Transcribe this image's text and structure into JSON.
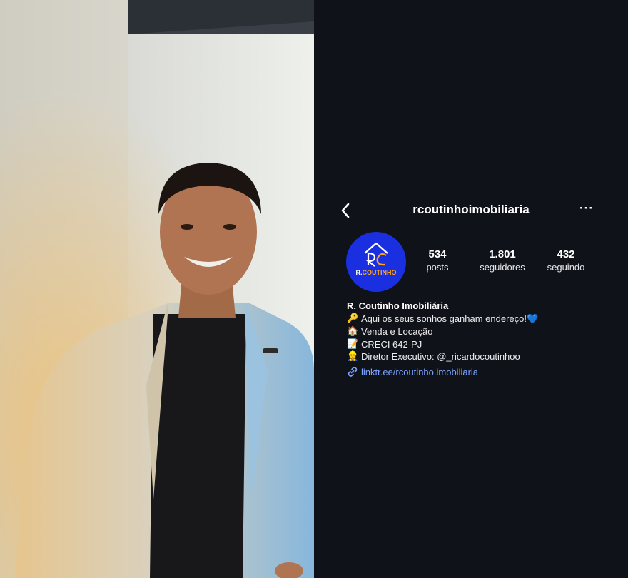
{
  "photo": {
    "alt": ""
  },
  "header": {
    "username": "rcoutinhoimobiliaria",
    "back_icon": "chevron-left-icon",
    "more_icon": "more-horizontal-icon",
    "more_label": "···"
  },
  "avatar": {
    "brand_first": "R.",
    "brand_second": "COUTINHO",
    "logo_initials": "RC"
  },
  "stats": [
    {
      "value": "534",
      "label": "posts"
    },
    {
      "value": "1.801",
      "label": "seguidores"
    },
    {
      "value": "432",
      "label": "seguindo"
    }
  ],
  "bio": {
    "name": "R. Coutinho Imobiliária",
    "lines": [
      {
        "icon": "key-icon",
        "glyph": "🔑",
        "text": "Aqui os seus sonhos ganham endereço!",
        "suffix": "💙"
      },
      {
        "icon": "house-icon",
        "glyph": "🏠",
        "text": "Venda e Locação"
      },
      {
        "icon": "memo-icon",
        "glyph": "📝",
        "text": "CRECI 642-PJ"
      },
      {
        "icon": "worker-icon",
        "glyph": "👷",
        "text": "Diretor Executivo: @_ricardocoutinhoo"
      }
    ],
    "link": {
      "icon": "link-icon",
      "text": "linktr.ee/rcoutinho.imobiliaria"
    }
  },
  "colors": {
    "background": "#101219",
    "avatar_bg": "#1a2fe0",
    "brand_orange": "#ffa51a",
    "link": "#7ca5ff"
  }
}
